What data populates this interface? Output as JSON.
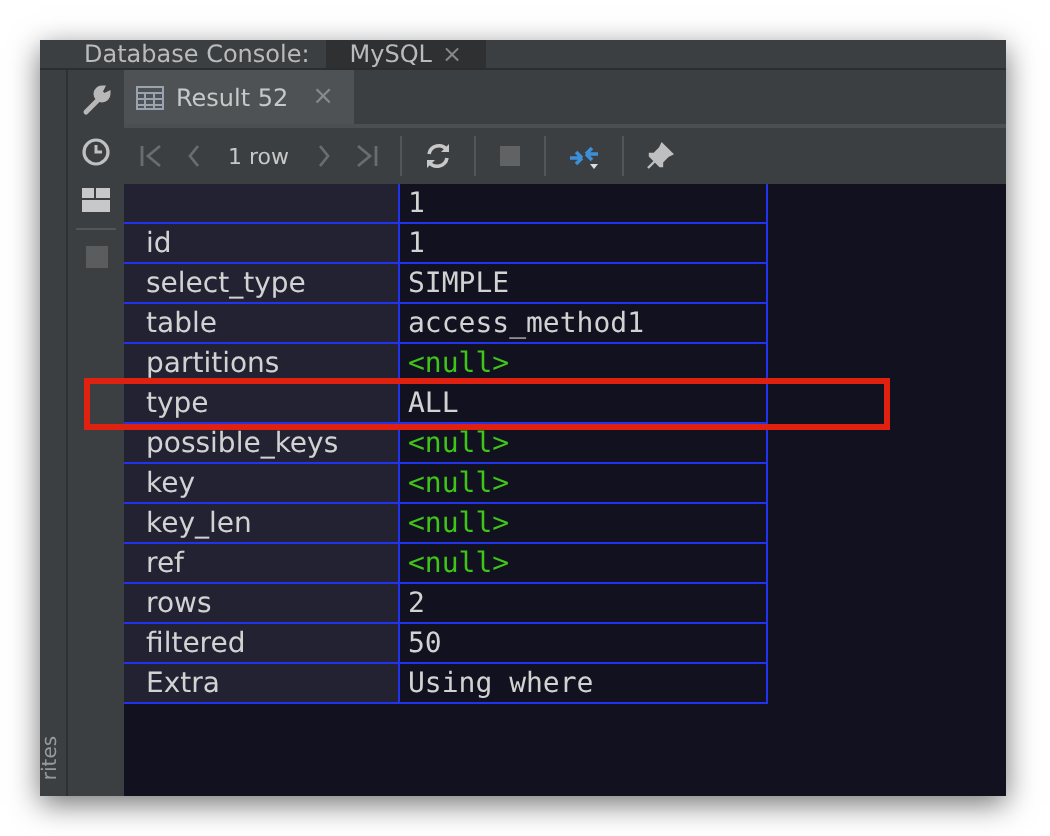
{
  "console_bar": {
    "label": "Database Console:",
    "tabs": [
      {
        "label": "MySQL",
        "close": "×",
        "selected": true
      }
    ]
  },
  "side_panel": {
    "label": "rites"
  },
  "result_tabs": [
    {
      "label": "Result 52",
      "close": "×",
      "selected": true
    }
  ],
  "toolbar": {
    "row_count": "1 row"
  },
  "table": {
    "columns": [
      "",
      "1"
    ],
    "rows": [
      {
        "name": "id",
        "value": "1",
        "null": false,
        "highlighted": false
      },
      {
        "name": "select_type",
        "value": "SIMPLE",
        "null": false,
        "highlighted": false
      },
      {
        "name": "table",
        "value": "access_method1",
        "null": false,
        "highlighted": false
      },
      {
        "name": "partitions",
        "value": "<null>",
        "null": true,
        "highlighted": false
      },
      {
        "name": "type",
        "value": "ALL",
        "null": false,
        "highlighted": true
      },
      {
        "name": "possible_keys",
        "value": "<null>",
        "null": true,
        "highlighted": false
      },
      {
        "name": "key",
        "value": "<null>",
        "null": true,
        "highlighted": false
      },
      {
        "name": "key_len",
        "value": "<null>",
        "null": true,
        "highlighted": false
      },
      {
        "name": "ref",
        "value": "<null>",
        "null": true,
        "highlighted": false
      },
      {
        "name": "rows",
        "value": "2",
        "null": false,
        "highlighted": false
      },
      {
        "name": "filtered",
        "value": "50",
        "null": false,
        "highlighted": false
      },
      {
        "name": "Extra",
        "value": "Using where",
        "null": false,
        "highlighted": false
      }
    ]
  }
}
